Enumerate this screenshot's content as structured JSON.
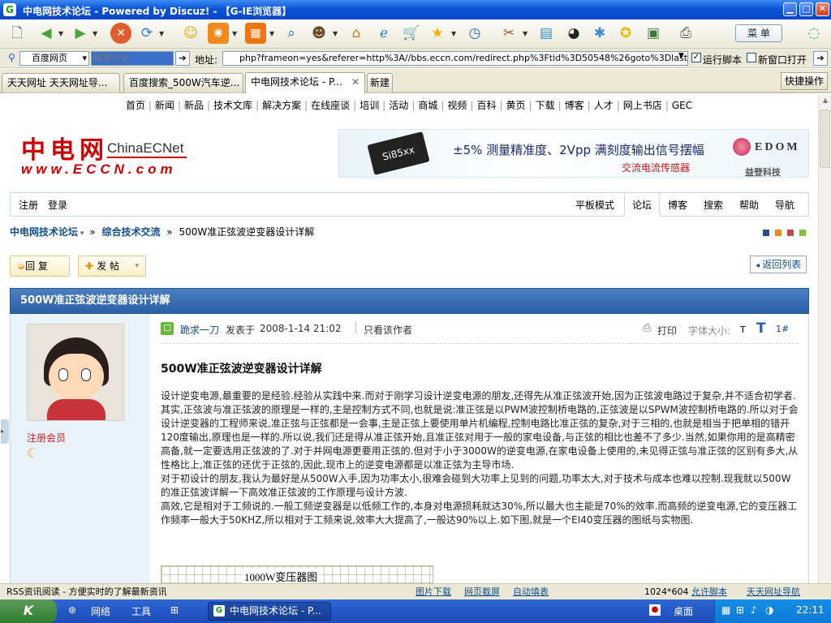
{
  "window": {
    "app_icon": "G",
    "title": "中电网技术论坛 - Powered by Discuz! - 【G-IE浏览器】",
    "min": "▁",
    "max": "□",
    "close": "✕"
  },
  "toolbar": {
    "icons": [
      "new-page-icon",
      "back-icon",
      "forward-icon",
      "stop-icon",
      "refresh-icon",
      "smiley-icon",
      "rss-icon",
      "home-grid-icon",
      "search-icon",
      "user-icon",
      "home-icon",
      "ie-icon",
      "cart-icon",
      "favorite-star-icon",
      "history-icon",
      "tools-icon",
      "book-icon",
      "panda-icon",
      "plugin-icon",
      "star-badge-icon",
      "photo-icon",
      "print-icon"
    ],
    "menu_label": "菜 单"
  },
  "address": {
    "search_engine": "百度网页",
    "search_placeholder": "搜索大全",
    "address_label": "地址:",
    "url": "php?frameon=yes&referer=http%3A//bbs.eccn.com/redirect.php%3Ftid%3D50548%26goto%3Dlastpost",
    "run_script": "运行脚本",
    "new_window": "新窗口打开"
  },
  "tabs": [
    {
      "label": "天天网址 天天网址导..."
    },
    {
      "label": "百度搜索_500W汽车逆..."
    },
    {
      "label": "中电网技术论坛 - P..."
    },
    {
      "label": "新建"
    }
  ],
  "quick_action": "快捷操作",
  "topnav": [
    "首页",
    "新闻",
    "新品",
    "技术文库",
    "解决方案",
    "在线座谈",
    "培训",
    "活动",
    "商城",
    "视频",
    "百科",
    "黄页",
    "下载",
    "博客",
    "人才",
    "网上书店",
    "GEC"
  ],
  "logo": {
    "cn": "中电网",
    "en": "ChinaECNet",
    "url": "www.ECCN.com"
  },
  "banner": {
    "chip": "Si85xx",
    "headline": "±5% 测量精准度、2Vpp 满刻度输出信号摆幅",
    "sub": "交流电流传感器",
    "brand": "EDOM",
    "brand_cn": "益登科技"
  },
  "navbar": {
    "left": [
      "注册",
      "登录"
    ],
    "right": [
      "平板模式",
      "论坛",
      "博客",
      "搜索",
      "帮助",
      "导航"
    ]
  },
  "breadcrumb": {
    "home": "中电网技术论坛",
    "sep": "»",
    "section": "综合技术交流",
    "current": "500W准正弦波逆变器设计详解"
  },
  "actions": {
    "reply": "回 复",
    "post": "发 帖",
    "back": "返回列表"
  },
  "thread_title": "500W准正弦波逆变器设计详解",
  "post": {
    "author": "跪求一刀",
    "posted_at": "发表于",
    "date": "2008-1-14 21:02",
    "only_author": "只看该作者",
    "print": "打印",
    "font_size": "字体大小:",
    "font_small": "T",
    "font_large": "T",
    "floor": "1#",
    "member_role": "注册会员",
    "heading": "500W准正弦波逆变器设计详解",
    "paragraphs": [
      "设计逆变电源,最重要的是经验.经验从实践中来.而对于刚学习设计逆变电源的朋友,还得先从准正弦波开始,因为正弦波电路过于复杂,并不适合初学者.其实,正弦波与准正弦波的原理是一样的,主是控制方式不同,也就是说:准正弦是以PWM波控制桥电路的,正弦波是以SPWM波控制桥电路的.所以对于会设计逆变器的工程师来说,准正弦与正弦都是一会事,主是正弦上要使用单片机编程,控制电路比准正弦的复杂,对于三相的,也就是相当于把单相的错开120度输出,原理也是一样的.所以说,我们还是得从准正弦开始,且准正弦对用于一般的家电设备,与正弦的相比也差不了多少.当然,如果你用的是高精密高备,就一定要选用正弦波的了.对于并网电源更要用正弦的.但对于小于3000W的逆变电源,在家电设备上使用的,未见得正弦与准正弦的区别有多大,从性格比上,准正弦的还优于正弦的,因此,现市上的逆变电源都是以准正弦为主导市场.",
      "对于初设计的朋友,我认为最好是从500W入手,因为功率太小,很难会碰到大功率上见到的问题,功率太大,对于技术与成本也难以控制.现我就以500W的准正弦波详解一下高效准正弦波的工作原理与设计方波.",
      "高效,它是相对于工频说的.一般工频逆变器是以低频工作的,本身对电源损耗就达30%,所以最大也主能是70%的效率.而高频的逆变电源,它的变压器工作频率一般大于50KHZ,所以相对于工频来说,效率大大提高了,一般达90%以上.如下图,就是一个EI40变压器的图纸与实物图."
    ],
    "figure_caption": "1000W变压器图"
  },
  "statusbar": {
    "rss": "RSS资讯阅读 - 方便实时的了解最新资讯",
    "links": [
      "图片下载",
      "网页截屏",
      "自动填表"
    ],
    "resolution": "1024*604",
    "allow_script": "允许脚本",
    "nav": "天天网址导航"
  },
  "taskbar": {
    "items": [
      "网络",
      "工具"
    ],
    "active_window": "中电网技术论坛 - P...",
    "desktop": "桌面",
    "time": "22:11"
  }
}
